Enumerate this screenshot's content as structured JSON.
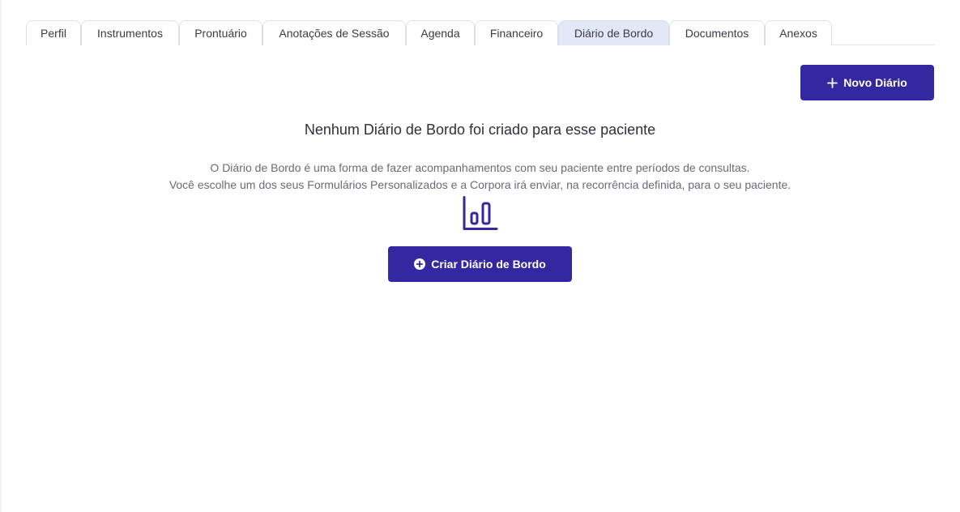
{
  "tabs": [
    {
      "label": "Perfil"
    },
    {
      "label": "Instrumentos"
    },
    {
      "label": "Prontuário"
    },
    {
      "label": "Anotações de Sessão"
    },
    {
      "label": "Agenda"
    },
    {
      "label": "Financeiro"
    },
    {
      "label": "Diário de Bordo",
      "active": true
    },
    {
      "label": "Documentos"
    },
    {
      "label": "Anexos"
    }
  ],
  "toolbar": {
    "new_label": "Novo Diário",
    "new_icon": "plus-icon"
  },
  "empty_state": {
    "title": "Nenhum Diário de Bordo foi criado para esse paciente",
    "description_line1": "O Diário de Bordo é uma forma de fazer acompanhamentos com seu paciente entre períodos de consultas.",
    "description_line2": "Você escolhe um dos seus Formulários Personalizados e a Corpora irá enviar, na recorrência definida, para o seu paciente.",
    "illustration_icon": "bar-chart-icon",
    "create_label": "Criar Diário de Bordo",
    "create_icon": "plus-circle-icon"
  },
  "colors": {
    "accent": "#3328a0",
    "active_tab": "#e3e8f8"
  }
}
